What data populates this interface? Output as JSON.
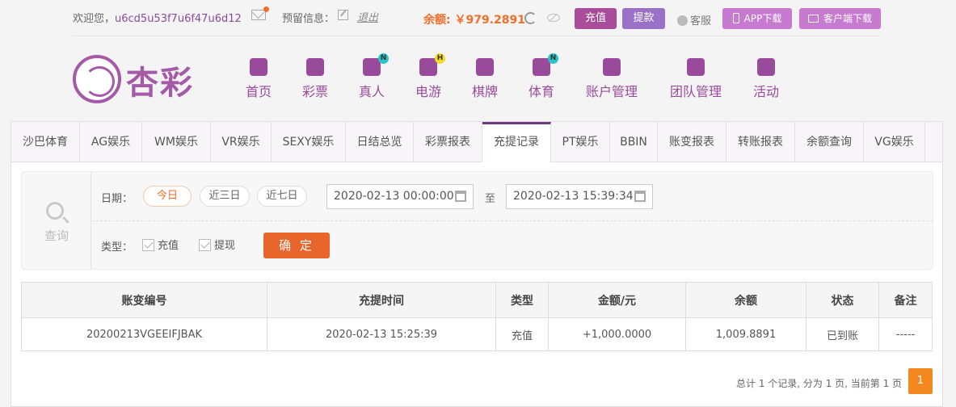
{
  "topbar": {
    "welcome": "欢迎您，",
    "username": "u6cd5u53f7u6f47u6d12",
    "reserve_label": "预留信息：",
    "logout": "退出",
    "balance": "余额: ￥979.2891",
    "recharge": "充值",
    "withdraw": "提款",
    "service": "客服",
    "app_download": "APP下载",
    "client_download": "客户端下载"
  },
  "logo": {
    "text": "杏彩"
  },
  "nav": [
    {
      "label": "首页",
      "icon": "home-icon",
      "badge": ""
    },
    {
      "label": "彩票",
      "icon": "lottery-icon",
      "badge": ""
    },
    {
      "label": "真人",
      "icon": "dealer-icon",
      "badge": "N"
    },
    {
      "label": "电游",
      "icon": "gamepad-icon",
      "badge": "H"
    },
    {
      "label": "棋牌",
      "icon": "cards-icon",
      "badge": ""
    },
    {
      "label": "体育",
      "icon": "trophy-icon",
      "badge": "N"
    },
    {
      "label": "账户管理",
      "icon": "account-icon",
      "badge": ""
    },
    {
      "label": "团队管理",
      "icon": "team-icon",
      "badge": ""
    },
    {
      "label": "活动",
      "icon": "gift-icon",
      "badge": ""
    }
  ],
  "tabs": [
    "沙巴体育",
    "AG娱乐",
    "WM娱乐",
    "VR娱乐",
    "SEXY娱乐",
    "日结总览",
    "彩票报表",
    "充提记录",
    "PT娱乐",
    "BBIN",
    "账变报表",
    "转账报表",
    "余额查询",
    "VG娱乐"
  ],
  "active_tab": "充提记录",
  "search": {
    "side_label": "查询",
    "date_label": "日期：",
    "quick_ranges": [
      "今日",
      "近三日",
      "近七日"
    ],
    "start": "2020-02-13 00:00:00",
    "to": "至",
    "end": "2020-02-13 15:39:34",
    "type_label": "类型：",
    "types": [
      "充值",
      "提现"
    ],
    "confirm": "确 定"
  },
  "table": {
    "headers": [
      "账变编号",
      "充提时间",
      "类型",
      "金额/元",
      "余额",
      "状态",
      "备注"
    ],
    "rows": [
      [
        "20200213VGEEIFJBAK",
        "2020-02-13 15:25:39",
        "充值",
        "+1,000.0000",
        "1,009.8891",
        "已到账",
        "-----"
      ]
    ]
  },
  "pager": {
    "summary": "总计 1 个记录, 分为 1 页, 当前第 1 页",
    "page": "1"
  },
  "colors": {
    "brand": "#a45aa6",
    "accent": "#f26f2a",
    "tab_active": "#6b3b7e",
    "success": "#3fa43f"
  }
}
